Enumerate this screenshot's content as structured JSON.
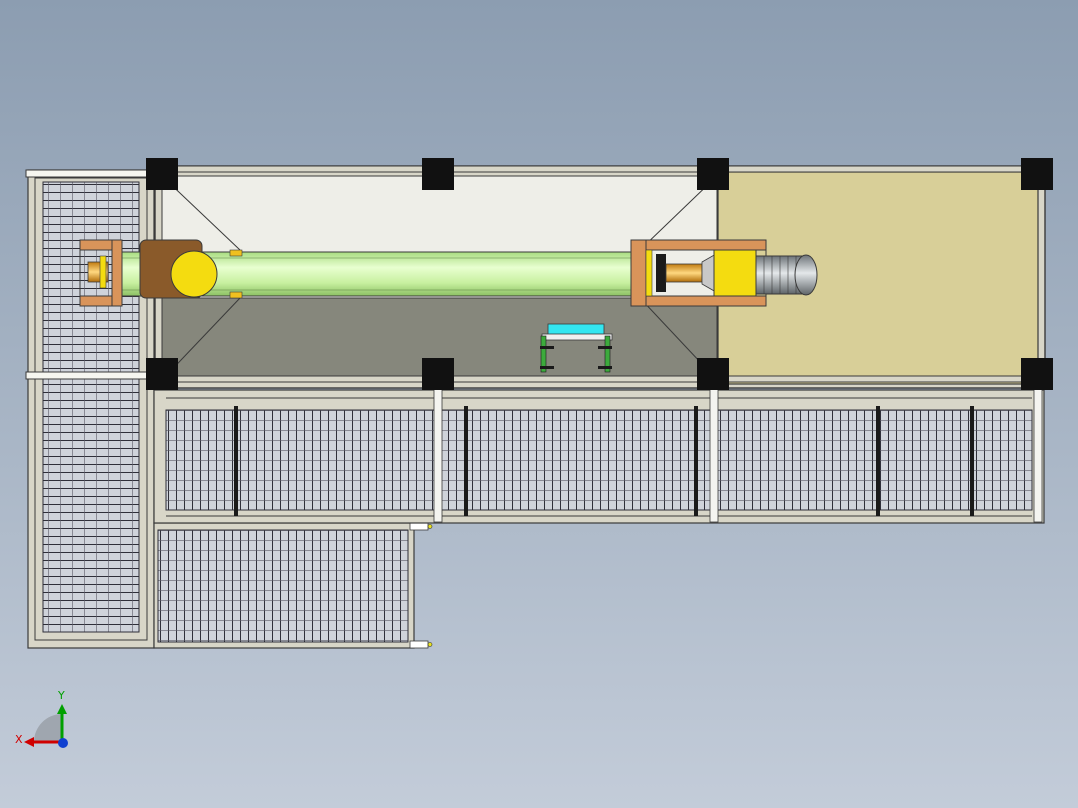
{
  "view": {
    "background_top": "#8c9db1",
    "background_bottom": "#c3ccd9"
  },
  "colors": {
    "frame": "#d8d6c8",
    "frame_edge": "#3a3a3a",
    "post": "#111111",
    "grating_bg": "#cfd3da",
    "grating_line": "#2e2e38",
    "hopper_light": "#eeeee8",
    "hopper_dark": "#86877c",
    "motor_deck": "#d8cf98",
    "tube": "#c8f0a0",
    "tube_highlight": "#e8ffd0",
    "bearing_frame": "#d9945a",
    "yellow_part": "#f4dc10",
    "motor_gray": "#9aa0a4",
    "cyan_part": "#33e6f0",
    "green_part": "#3caa3c",
    "bronze": "#8a5a2a"
  },
  "triad": {
    "x_label": "X",
    "y_label": "Y",
    "x_color": "#d00000",
    "y_color": "#00a000",
    "z_color": "#1040d0"
  }
}
